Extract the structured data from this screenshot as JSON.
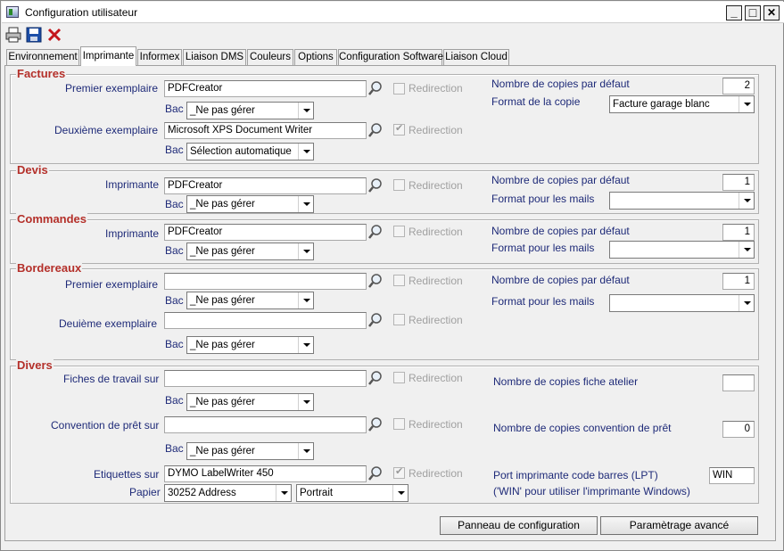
{
  "window": {
    "title": "Configuration utilisateur",
    "minimize": "_",
    "maximize": "□",
    "close": "✕"
  },
  "toolbar": {
    "icons": [
      "printer-icon",
      "save-icon",
      "delete-icon"
    ]
  },
  "tabs": [
    {
      "label": "Environnement",
      "active": false
    },
    {
      "label": "Imprimante",
      "active": true
    },
    {
      "label": "Informex",
      "active": false
    },
    {
      "label": "Liaison DMS",
      "active": false
    },
    {
      "label": "Couleurs",
      "active": false
    },
    {
      "label": "Options",
      "active": false
    },
    {
      "label": "Configuration Software",
      "active": false
    },
    {
      "label": "Liaison Cloud",
      "active": false
    }
  ],
  "common": {
    "redirection": "Redirection",
    "bac": "Bac",
    "copies_default": "Nombre de copies par défaut",
    "format_mails": "Format pour les mails"
  },
  "factures": {
    "title": "Factures",
    "premier_label": "Premier exemplaire",
    "premier_value": "PDFCreator",
    "premier_redirection": false,
    "bac1_value": "_Ne pas gérer",
    "deuxieme_label": "Deuxième exemplaire",
    "deuxieme_value": "Microsoft XPS Document Writer",
    "deuxieme_redirection": true,
    "bac2_value": "Sélection automatique",
    "copies_value": "2",
    "format_label": "Format de la copie",
    "format_value": "Facture garage blanc"
  },
  "devis": {
    "title": "Devis",
    "imprimante_label": "Imprimante",
    "imprimante_value": "PDFCreator",
    "bac_value": "_Ne pas gérer",
    "copies_value": "1",
    "format_value": ""
  },
  "commandes": {
    "title": "Commandes",
    "imprimante_label": "Imprimante",
    "imprimante_value": "PDFCreator",
    "bac_value": "_Ne pas gérer",
    "copies_value": "1",
    "format_value": ""
  },
  "bordereaux": {
    "title": "Bordereaux",
    "premier_label": "Premier exemplaire",
    "premier_value": "",
    "bac1_value": "_Ne pas gérer",
    "deuxieme_label": "Deuième exemplaire",
    "deuxieme_value": "",
    "bac2_value": "_Ne pas gérer",
    "copies_value": "1",
    "format_value": ""
  },
  "divers": {
    "title": "Divers",
    "fiches_label": "Fiches de travail sur",
    "fiches_value": "",
    "bac1_value": "_Ne pas gérer",
    "convention_label": "Convention de prêt sur",
    "convention_value": "",
    "bac2_value": "_Ne pas gérer",
    "etiquettes_label": "Etiquettes sur",
    "etiquettes_value": "DYMO LabelWriter 450",
    "etiquettes_redirection": true,
    "papier_label": "Papier",
    "papier_value": "30252 Address",
    "orientation_value": "Portrait",
    "copies_fiche_label": "Nombre de copies fiche atelier",
    "copies_fiche_value": "",
    "copies_conv_label": "Nombre de copies convention de prêt",
    "copies_conv_value": "0",
    "port_label": "Port imprimante code barres (LPT)",
    "port_value": "WIN",
    "port_note": "('WIN' pour utiliser l'imprimante Windows)"
  },
  "buttons": {
    "panneau": "Panneau de configuration",
    "parametrage": "Paramètrage avancé"
  }
}
